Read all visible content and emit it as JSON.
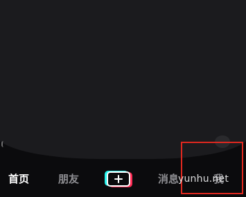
{
  "tabbar": {
    "home_label": "首页",
    "friends_label": "朋友",
    "messages_label": "消息",
    "me_label": "我",
    "create_icon": "plus-icon"
  },
  "colors": {
    "active_tab": "#ffffff",
    "inactive_tab": "#8e8e92",
    "create_cyan": "#25f4ee",
    "create_pink": "#fe2c55",
    "highlight_box": "#e0281f",
    "background": "#0b0b0d"
  },
  "overlay": {
    "watermark_text": "yunhu.net"
  }
}
